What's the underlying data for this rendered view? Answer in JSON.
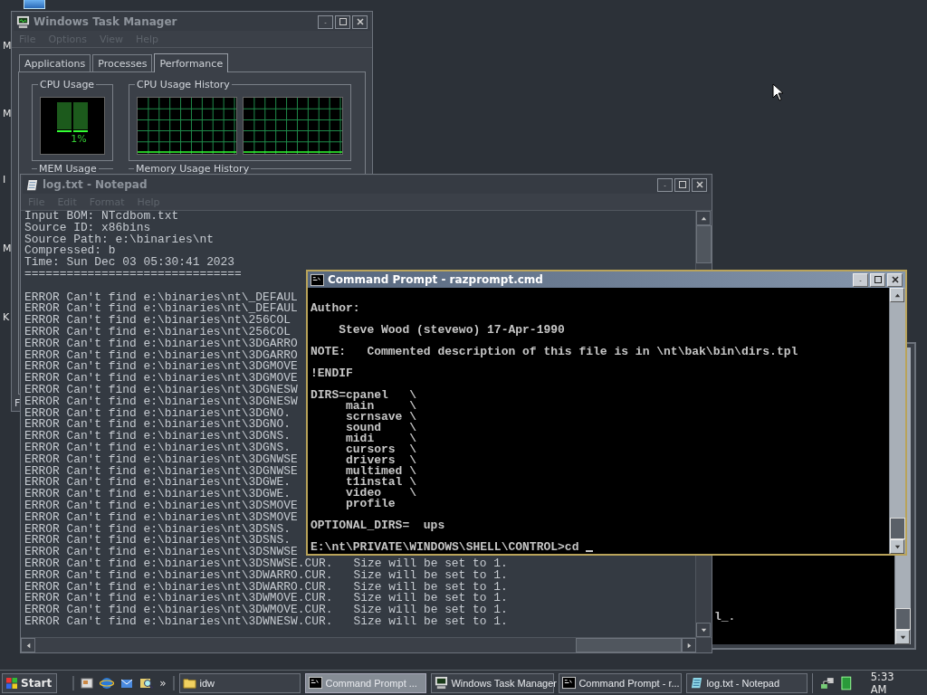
{
  "desktop": {
    "icon_labels": [
      "M",
      "M",
      "I",
      "M",
      "K"
    ]
  },
  "task_manager": {
    "title": "Windows Task Manager",
    "active": false,
    "menu": [
      "File",
      "Options",
      "View",
      "Help"
    ],
    "tabs": [
      {
        "label": "Applications",
        "selected": false
      },
      {
        "label": "Processes",
        "selected": false
      },
      {
        "label": "Performance",
        "selected": true
      }
    ],
    "cpu_usage": {
      "label": "CPU Usage",
      "reading": "1%"
    },
    "cpu_history": {
      "label": "CPU Usage History"
    },
    "mem_usage": {
      "label": "MEM Usage"
    },
    "memory_history": {
      "label": "Memory Usage History"
    },
    "status_bar": "F"
  },
  "notepad": {
    "title": "log.txt - Notepad",
    "active": false,
    "menu": [
      "File",
      "Edit",
      "Format",
      "Help"
    ],
    "header_lines": [
      "Input BOM: NTcdbom.txt",
      "Source ID: x86bins",
      "Source Path: e:\\binaries\\nt",
      "Compressed: b",
      "Time: Sun Dec 03 05:30:41 2023",
      "==============================="
    ],
    "error_lines": [
      "ERROR Can't find e:\\binaries\\nt\\_DEFAUL",
      "ERROR Can't find e:\\binaries\\nt\\_DEFAUL",
      "ERROR Can't find e:\\binaries\\nt\\256COL",
      "ERROR Can't find e:\\binaries\\nt\\256COL",
      "ERROR Can't find e:\\binaries\\nt\\3DGARRO",
      "ERROR Can't find e:\\binaries\\nt\\3DGARRO",
      "ERROR Can't find e:\\binaries\\nt\\3DGMOVE",
      "ERROR Can't find e:\\binaries\\nt\\3DGMOVE",
      "ERROR Can't find e:\\binaries\\nt\\3DGNESW",
      "ERROR Can't find e:\\binaries\\nt\\3DGNESW",
      "ERROR Can't find e:\\binaries\\nt\\3DGNO.",
      "ERROR Can't find e:\\binaries\\nt\\3DGNO.",
      "ERROR Can't find e:\\binaries\\nt\\3DGNS.",
      "ERROR Can't find e:\\binaries\\nt\\3DGNS.",
      "ERROR Can't find e:\\binaries\\nt\\3DGNWSE",
      "ERROR Can't find e:\\binaries\\nt\\3DGNWSE",
      "ERROR Can't find e:\\binaries\\nt\\3DGWE.",
      "ERROR Can't find e:\\binaries\\nt\\3DGWE.",
      "ERROR Can't find e:\\binaries\\nt\\3DSMOVE",
      "ERROR Can't find e:\\binaries\\nt\\3DSMOVE",
      "ERROR Can't find e:\\binaries\\nt\\3DSNS.",
      "ERROR Can't find e:\\binaries\\nt\\3DSNS.",
      "ERROR Can't find e:\\binaries\\nt\\3DSNWSE",
      "ERROR Can't find e:\\binaries\\nt\\3DSNWSE.CUR.   Size will be set to 1.",
      "ERROR Can't find e:\\binaries\\nt\\3DWARRO.CUR.   Size will be set to 1.",
      "ERROR Can't find e:\\binaries\\nt\\3DWARRO.CUR.   Size will be set to 1.",
      "ERROR Can't find e:\\binaries\\nt\\3DWMOVE.CUR.   Size will be set to 1.",
      "ERROR Can't find e:\\binaries\\nt\\3DWMOVE.CUR.   Size will be set to 1.",
      "ERROR Can't find e:\\binaries\\nt\\3DWNESW.CUR.   Size will be set to 1."
    ]
  },
  "back_console": {
    "line": "l_."
  },
  "command_prompt": {
    "title": "Command Prompt - razprompt.cmd",
    "active": true,
    "blocks": [
      [
        "Author:"
      ],
      [
        "    Steve Wood (stevewo) 17-Apr-1990"
      ],
      [
        "NOTE:   Commented description of this file is in \\nt\\bak\\bin\\dirs.tpl"
      ],
      [
        "!ENDIF"
      ],
      [
        "DIRS=cpanel   \\",
        "     main     \\",
        "     scrnsave \\",
        "     sound    \\",
        "     midi     \\",
        "     cursors  \\",
        "     drivers  \\",
        "     multimed \\",
        "     t1instal \\",
        "     video    \\",
        "     profile"
      ],
      [
        "OPTIONAL_DIRS=  ups"
      ]
    ],
    "prompt": "E:\\nt\\PRIVATE\\WINDOWS\\SHELL\\CONTROL>cd"
  },
  "taskbar": {
    "start": "Start",
    "more": "»",
    "buttons": [
      {
        "label": "idw",
        "kind": "folder",
        "selected": false
      },
      {
        "label": "Command Prompt ...",
        "kind": "console",
        "selected": true
      },
      {
        "label": "Windows Task Manager",
        "kind": "monitor",
        "selected": false
      },
      {
        "label": "Command Prompt - r...",
        "kind": "console",
        "selected": false
      },
      {
        "label": "log.txt - Notepad",
        "kind": "notepad",
        "selected": false
      }
    ],
    "clock": "5:33 AM"
  }
}
